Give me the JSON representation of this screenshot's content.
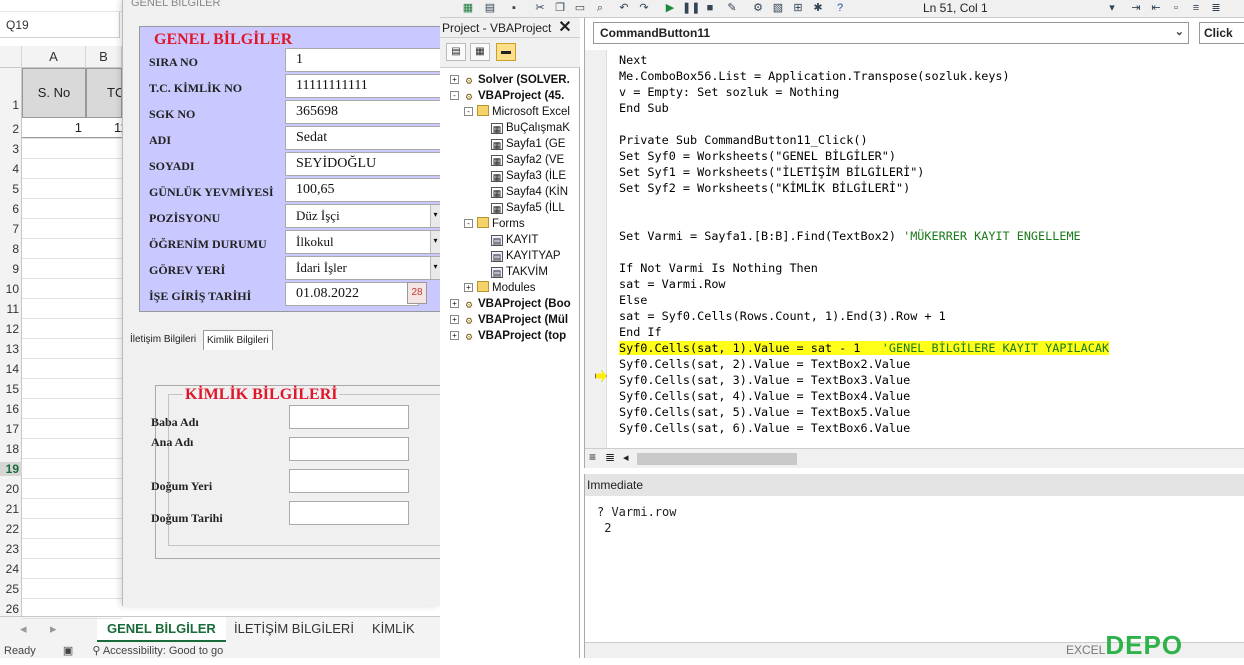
{
  "excel": {
    "name_box": "Q19",
    "columns": [
      "A",
      "B"
    ],
    "header_row": [
      "S. No",
      "TC"
    ],
    "row2": [
      "1",
      "111"
    ],
    "row_numbers": [
      "1",
      "2",
      "3",
      "4",
      "5",
      "6",
      "7",
      "8",
      "9",
      "10",
      "11",
      "12",
      "13",
      "14",
      "15",
      "16",
      "17",
      "18",
      "19",
      "20",
      "21",
      "22",
      "23",
      "24",
      "25",
      "26"
    ],
    "sheet_tabs": [
      "GENEL BİLGİLER",
      "İLETİŞİM BİLGİLERİ",
      "KİMLİK BİLG"
    ],
    "status": "Ready",
    "accessibility": "Accessibility: Good to go"
  },
  "userform": {
    "title": "GENEL BİLGİLER",
    "frame1_caption": "GENEL BİLGİLER",
    "fields": [
      {
        "label": "SIRA NO",
        "value": "1"
      },
      {
        "label": "T.C. KİMLİK NO",
        "value": "11111111111"
      },
      {
        "label": "SGK NO",
        "value": "365698"
      },
      {
        "label": "ADI",
        "value": "Sedat"
      },
      {
        "label": "SOYADI",
        "value": "SEYİDOĞLU"
      },
      {
        "label": "GÜNLÜK YEVMİYESİ",
        "value": "100,65"
      },
      {
        "label": "POZİSYONU",
        "value": "Düz İşçi"
      },
      {
        "label": "ÖĞRENİM DURUMU",
        "value": "İlkokul"
      },
      {
        "label": "GÖREV YERİ",
        "value": "İdari İşler"
      },
      {
        "label": "İŞE GİRİŞ TARİHİ",
        "value": "01.08.2022"
      }
    ],
    "calendar_icon_text": "28",
    "multipage_tabs": [
      "İletişim Bilgileri",
      "Kimlik Bilgileri"
    ],
    "frame2_caption": "KİMLİK BİLGİLERİ",
    "frame2_fields": [
      "Baba Adı",
      "Ana Adı",
      "Doğum Yeri",
      "Doğum Tarihi"
    ]
  },
  "vbe": {
    "status_position": "Ln 51, Col 1",
    "project_title": "Project - VBAProject",
    "tree": [
      {
        "label": "Solver (SOLVER.",
        "bold": true,
        "depth": 0,
        "exp": "+"
      },
      {
        "label": "VBAProject (45.",
        "bold": true,
        "depth": 0,
        "exp": "-"
      },
      {
        "label": "Microsoft Excel",
        "bold": false,
        "depth": 1,
        "exp": "-"
      },
      {
        "label": "BuÇalışmaK",
        "bold": false,
        "depth": 2,
        "exp": ""
      },
      {
        "label": "Sayfa1 (GE",
        "bold": false,
        "depth": 2,
        "exp": ""
      },
      {
        "label": "Sayfa2 (VE",
        "bold": false,
        "depth": 2,
        "exp": ""
      },
      {
        "label": "Sayfa3 (İLE",
        "bold": false,
        "depth": 2,
        "exp": ""
      },
      {
        "label": "Sayfa4 (KİN",
        "bold": false,
        "depth": 2,
        "exp": ""
      },
      {
        "label": "Sayfa5 (İLL",
        "bold": false,
        "depth": 2,
        "exp": ""
      },
      {
        "label": "Forms",
        "bold": false,
        "depth": 1,
        "exp": "-"
      },
      {
        "label": "KAYIT",
        "bold": false,
        "depth": 2,
        "exp": ""
      },
      {
        "label": "KAYITYAP",
        "bold": false,
        "depth": 2,
        "exp": ""
      },
      {
        "label": "TAKVİM",
        "bold": false,
        "depth": 2,
        "exp": ""
      },
      {
        "label": "Modules",
        "bold": false,
        "depth": 1,
        "exp": "+"
      },
      {
        "label": "VBAProject (Boo",
        "bold": true,
        "depth": 0,
        "exp": "+"
      },
      {
        "label": "VBAProject (Mül",
        "bold": true,
        "depth": 0,
        "exp": "+"
      },
      {
        "label": "VBAProject (top",
        "bold": true,
        "depth": 0,
        "exp": "+"
      }
    ],
    "object_combo": "CommandButton11",
    "procedure_combo": "Click",
    "code_lines": [
      "Next",
      "Me.ComboBox56.List = Application.Transpose(sozluk.keys)",
      "v = Empty: Set sozluk = Nothing",
      "End Sub",
      "",
      "Private Sub CommandButton11_Click()",
      "Set Syf0 = Worksheets(\"GENEL BİLGİLER\")",
      "Set Syf1 = Worksheets(\"İLETİŞİM BİLGİLERİ\")",
      "Set Syf2 = Worksheets(\"KİMLİK BİLGİLERİ\")",
      "",
      "",
      "Set Varmi = Sayfa1.[B:B].Find(TextBox2) ",
      "",
      "If Not Varmi Is Nothing Then",
      "sat = Varmi.Row",
      "Else",
      "sat = Syf0.Cells(Rows.Count, 1).End(3).Row + 1",
      "End If",
      "Syf0.Cells(sat, 1).Value = sat - 1   ",
      "Syf0.Cells(sat, 2).Value = TextBox2.Value",
      "Syf0.Cells(sat, 3).Value = TextBox3.Value",
      "Syf0.Cells(sat, 4).Value = TextBox4.Value",
      "Syf0.Cells(sat, 5).Value = TextBox5.Value",
      "Syf0.Cells(sat, 6).Value = TextBox6.Value"
    ],
    "comment_line11": "'MÜKERRER KAYIT ENGELLEME",
    "comment_line18": "'GENEL BİLGİLERE KAYIT YAPILACAK",
    "immediate_title": "Immediate",
    "immediate_lines": [
      "? Varmi.row",
      " 2"
    ]
  },
  "watermark": {
    "brand": "DEPO",
    "prefix": "EXCEL"
  }
}
